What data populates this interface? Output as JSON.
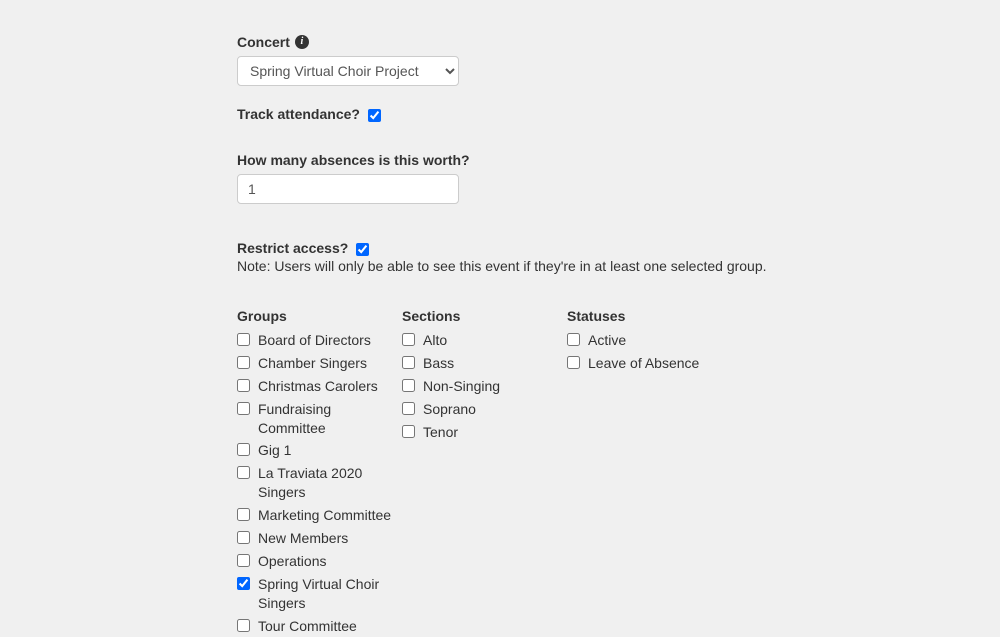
{
  "concert": {
    "label": "Concert",
    "selected": "Spring Virtual Choir Project"
  },
  "track_attendance": {
    "label": "Track attendance?",
    "checked": true
  },
  "absences": {
    "label": "How many absences is this worth?",
    "value": "1"
  },
  "restrict_access": {
    "label": "Restrict access?",
    "checked": true,
    "note": "Note: Users will only be able to see this event if they're in at least one selected group."
  },
  "groups": {
    "heading": "Groups",
    "items": [
      {
        "label": "Board of Directors",
        "checked": false
      },
      {
        "label": "Chamber Singers",
        "checked": false
      },
      {
        "label": "Christmas Carolers",
        "checked": false
      },
      {
        "label": "Fundraising Committee",
        "checked": false
      },
      {
        "label": "Gig 1",
        "checked": false
      },
      {
        "label": "La Traviata 2020 Singers",
        "checked": false
      },
      {
        "label": "Marketing Committee",
        "checked": false
      },
      {
        "label": "New Members",
        "checked": false
      },
      {
        "label": "Operations",
        "checked": false
      },
      {
        "label": "Spring Virtual Choir Singers",
        "checked": true
      },
      {
        "label": "Tour Committee",
        "checked": false
      }
    ]
  },
  "sections": {
    "heading": "Sections",
    "items": [
      {
        "label": "Alto",
        "checked": false
      },
      {
        "label": "Bass",
        "checked": false
      },
      {
        "label": "Non-Singing",
        "checked": false
      },
      {
        "label": "Soprano",
        "checked": false
      },
      {
        "label": "Tenor",
        "checked": false
      }
    ]
  },
  "statuses": {
    "heading": "Statuses",
    "items": [
      {
        "label": "Active",
        "checked": false
      },
      {
        "label": "Leave of Absence",
        "checked": false
      }
    ]
  }
}
